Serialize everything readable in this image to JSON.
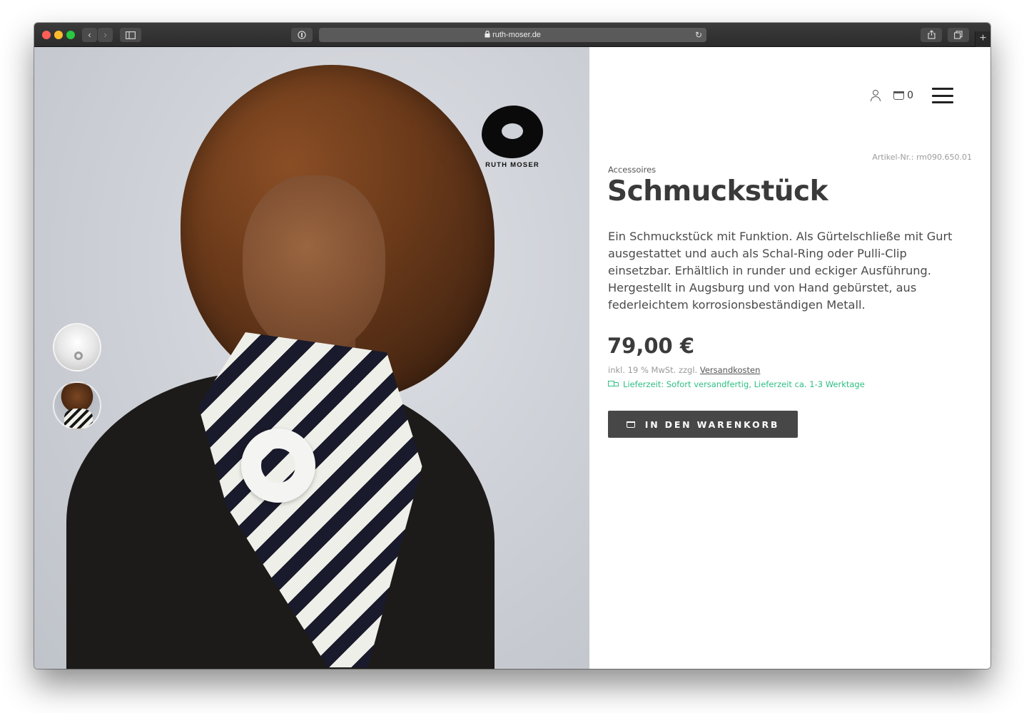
{
  "browser": {
    "url": "ruth-moser.de",
    "back_icon": "‹",
    "forward_icon": "›",
    "reload_icon": "↻",
    "newtab_icon": "+"
  },
  "brand": {
    "logo_text": "RUTH MOSER"
  },
  "header": {
    "cart_count": "0"
  },
  "product": {
    "article_nr": "Artikel-Nr.: rm090.650.01",
    "category": "Accessoires",
    "title": "Schmuckstück",
    "description": "Ein Schmuckstück mit Funktion. Als Gürtelschließe mit Gurt ausgestattet und auch als Schal-Ring oder Pulli-Clip einsetzbar. Erhältlich in runder und eckiger Ausführung. Hergestellt in Augsburg und von Hand gebürstet, aus federleichtem korrosionsbeständigen Metall.",
    "price": "79,00 €",
    "tax_prefix": "inkl. 19 % MwSt. zzgl.",
    "shipping_link": "Versandkosten",
    "delivery": "Lieferzeit: Sofort versandfertig, Lieferzeit ca. 1-3 Werktage",
    "add_to_cart": "IN DEN WARENKORB"
  },
  "colors": {
    "button_bg": "#474747",
    "delivery_green": "#2fbf82",
    "title_text": "#3a3a3a"
  },
  "icons": [
    "lock-icon",
    "user-icon",
    "basket-icon",
    "menu-icon",
    "truck-icon"
  ]
}
